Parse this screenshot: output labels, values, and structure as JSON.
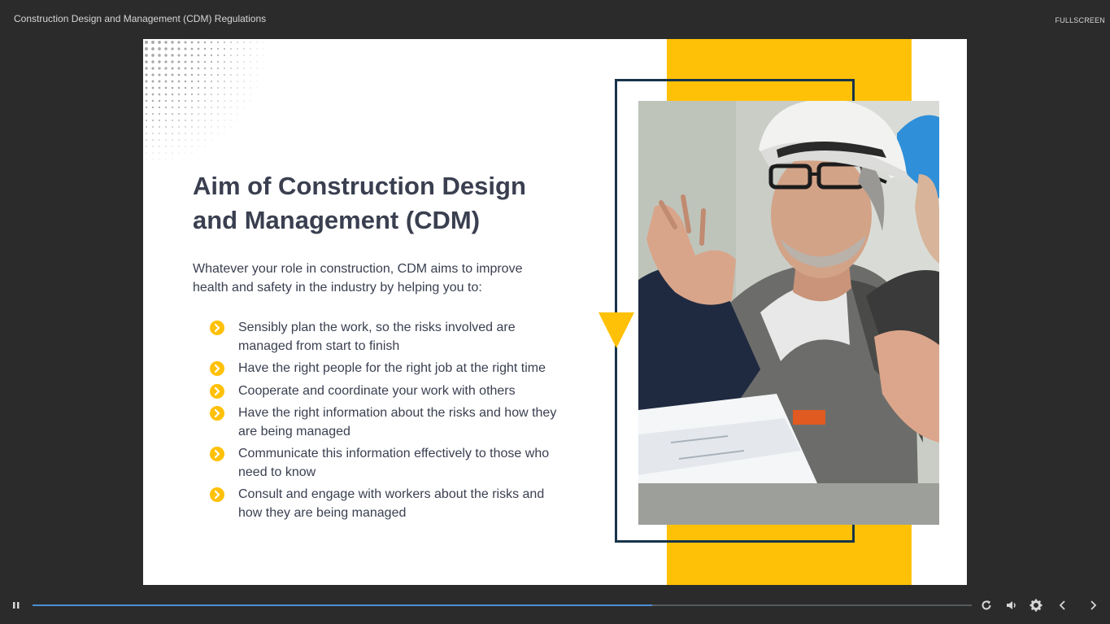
{
  "app": {
    "course_title": "Construction Design and Management (CDM) Regulations",
    "fullscreen_label": "FULLSCREEN"
  },
  "slide": {
    "heading": "Aim of Construction Design and Management (CDM)",
    "intro": "Whatever your role in construction, CDM aims to improve health and safety in the industry by helping you to:",
    "bullets": [
      "Sensibly plan the work, so the risks involved are managed from start to finish",
      "Have the right people for the right job at the right time",
      "Cooperate and coordinate your work with others",
      "Have the right information about the risks and how they are being managed",
      "Communicate this information effectively to those who need to know",
      "Consult and engage with workers about the risks and how they are being managed"
    ],
    "bullet_icon": "chevron-circle-right-icon",
    "image": "construction-workers-photo",
    "colors": {
      "accent": "#ffc107",
      "frame": "#17344a",
      "text": "#3a3f50"
    }
  },
  "player": {
    "progress": 0.66,
    "progress_color": "#4d8fd6",
    "icons": {
      "play_pause": "pause-icon",
      "replay": "replay-icon",
      "volume": "volume-icon",
      "settings": "gear-icon",
      "prev": "chevron-left-icon",
      "next": "chevron-right-icon"
    }
  }
}
